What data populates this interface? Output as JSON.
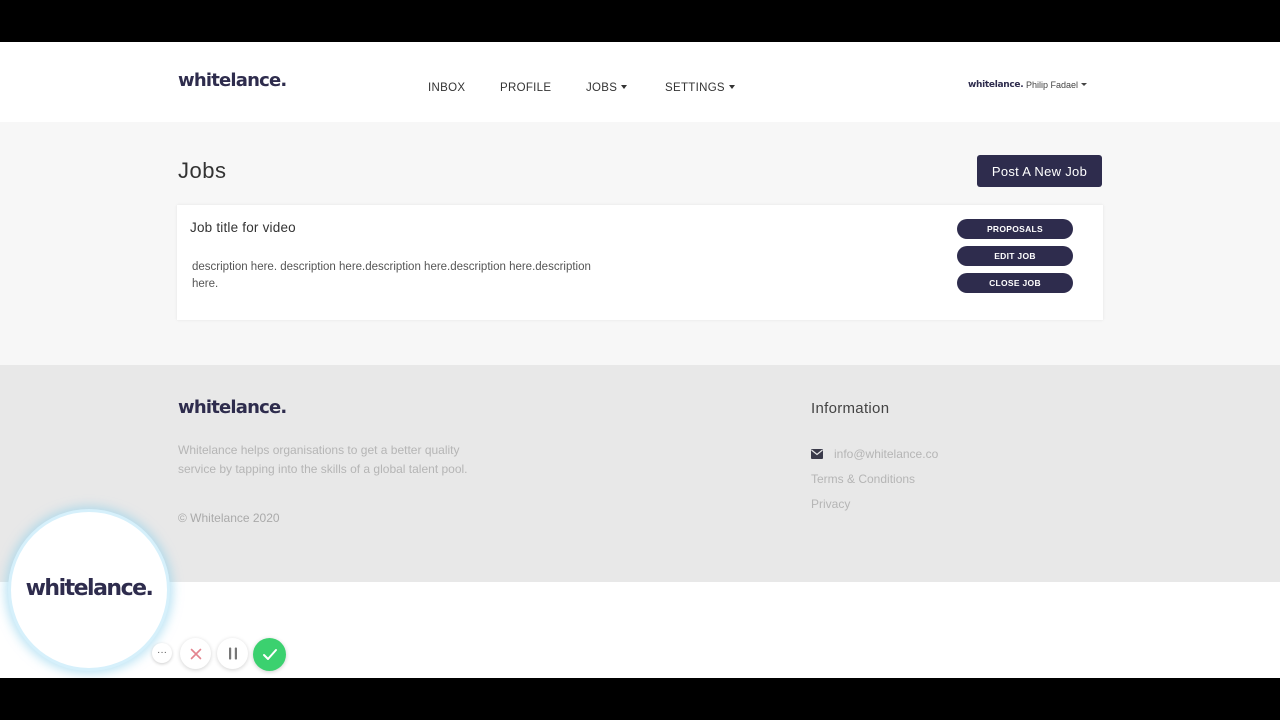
{
  "brand": {
    "logo": "whitelance.",
    "color_primary": "#2e2c4d"
  },
  "nav": {
    "items": [
      {
        "label": "INBOX",
        "has_dropdown": false
      },
      {
        "label": "PROFILE",
        "has_dropdown": false
      },
      {
        "label": "JOBS",
        "has_dropdown": true
      },
      {
        "label": "SETTINGS",
        "has_dropdown": true
      }
    ]
  },
  "user": {
    "avatar_logo": "whitelance.",
    "name": "Philip Fadael"
  },
  "jobs_page": {
    "title": "Jobs",
    "post_button": "Post A New Job",
    "job": {
      "title": "Job title for video",
      "description": "description here. description here.description here.description here.description here.",
      "actions": [
        "PROPOSALS",
        "EDIT JOB",
        "CLOSE JOB"
      ]
    }
  },
  "footer": {
    "logo": "whitelance.",
    "about": "Whitelance helps organisations to get a better quality service by tapping into the skills of a global talent pool.",
    "copyright": "© Whitelance 2020",
    "info_heading": "Information",
    "email": "info@whitelance.co",
    "terms": "Terms & Conditions",
    "privacy": "Privacy"
  },
  "recorder": {
    "bubble_logo": "whitelance.",
    "controls": {
      "more_icon": "ellipsis-icon",
      "more_label": "···",
      "close_icon": "close-icon",
      "pause_icon": "pause-icon",
      "done_icon": "check-icon",
      "done_color": "#3bd16f"
    }
  }
}
